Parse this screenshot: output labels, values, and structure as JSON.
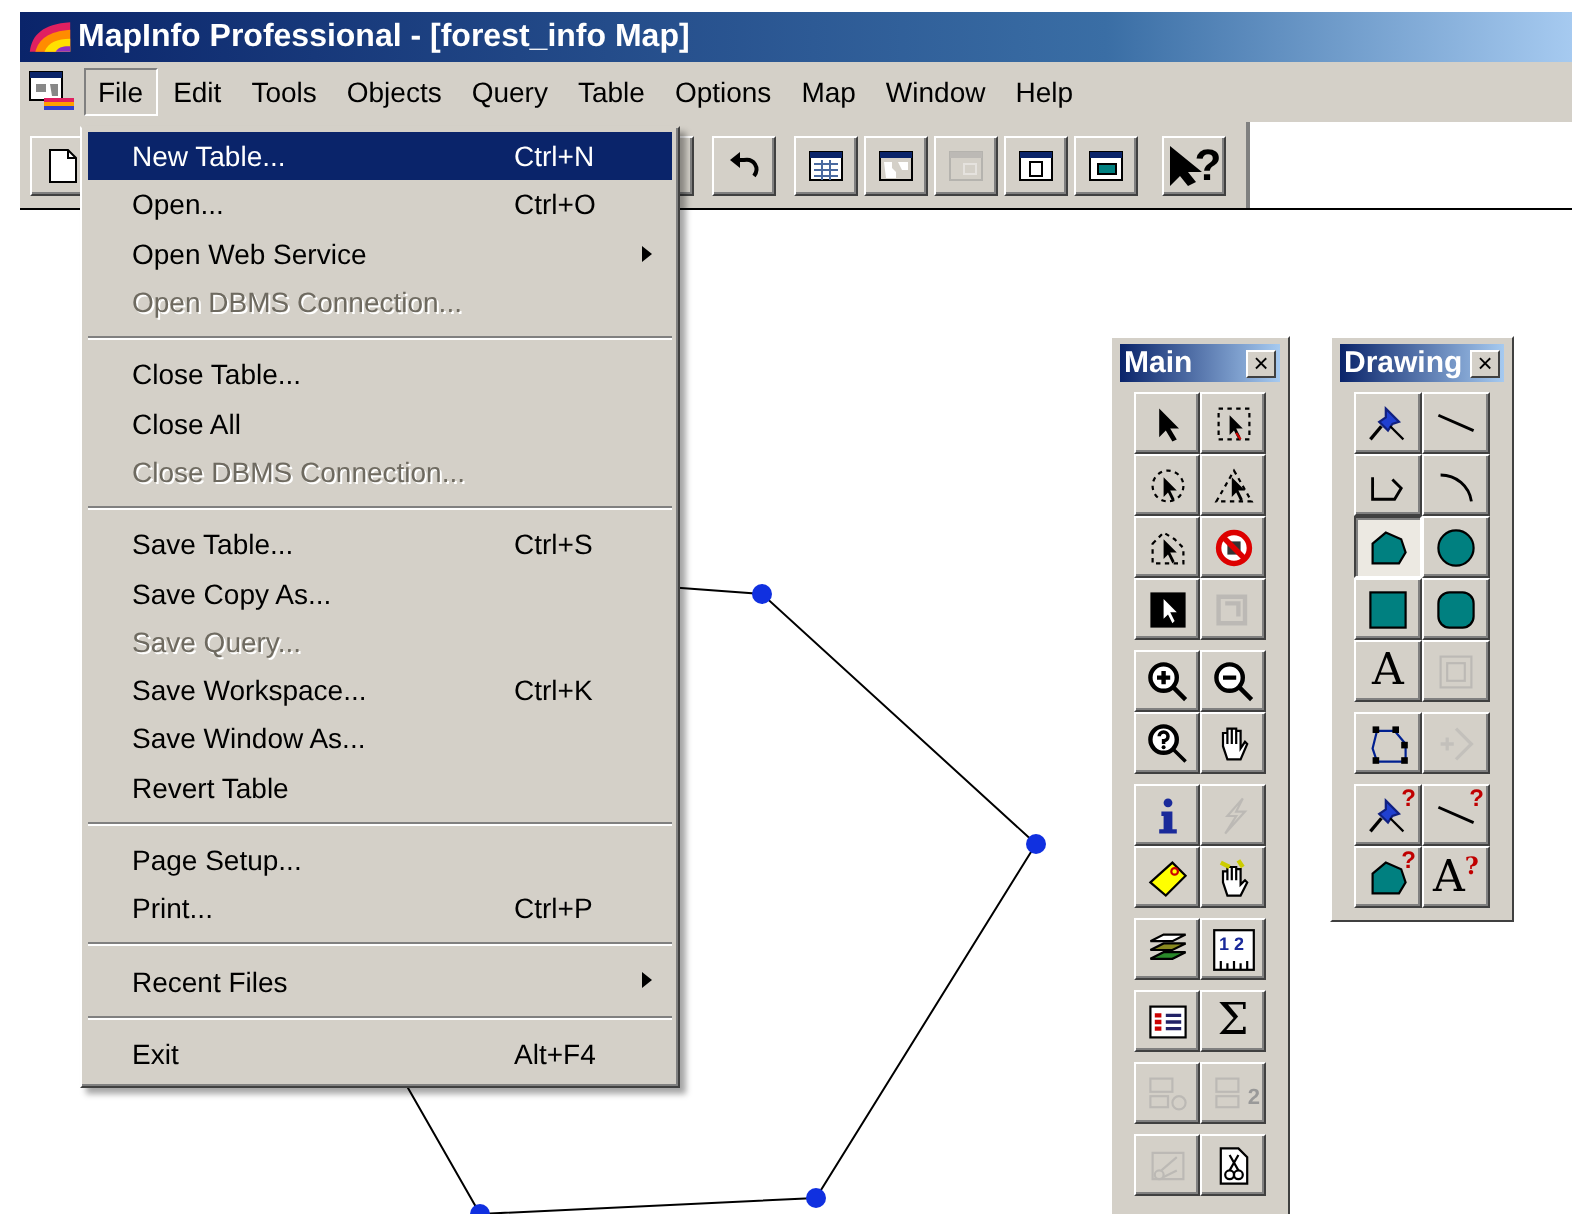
{
  "window": {
    "title": "MapInfo Professional - [forest_info Map]"
  },
  "menu_bar": [
    {
      "label": "File",
      "selected": true
    },
    {
      "label": "Edit",
      "selected": false
    },
    {
      "label": "Tools",
      "selected": false
    },
    {
      "label": "Objects",
      "selected": false
    },
    {
      "label": "Query",
      "selected": false
    },
    {
      "label": "Table",
      "selected": false
    },
    {
      "label": "Options",
      "selected": false
    },
    {
      "label": "Map",
      "selected": false
    },
    {
      "label": "Window",
      "selected": false
    },
    {
      "label": "Help",
      "selected": false
    }
  ],
  "toolbar": [
    [
      {
        "kind": "new-document",
        "disabled": false
      }
    ],
    [
      {
        "kind": "blank"
      }
    ],
    [
      {
        "kind": "undo",
        "disabled": false
      }
    ],
    [
      {
        "kind": "browser-window",
        "disabled": false
      },
      {
        "kind": "map-window",
        "disabled": false
      },
      {
        "kind": "layout-window",
        "disabled": true
      },
      {
        "kind": "graph-window",
        "disabled": false
      },
      {
        "kind": "district-window",
        "disabled": false
      }
    ],
    [
      {
        "kind": "help-pointer",
        "glyph": "?",
        "disabled": false
      }
    ]
  ],
  "file_menu": [
    {
      "kind": "item",
      "label": "New Table...",
      "shortcut": "Ctrl+N",
      "disabled": false,
      "selected": true
    },
    {
      "kind": "item",
      "label": "Open...",
      "shortcut": "Ctrl+O",
      "disabled": false,
      "selected": false
    },
    {
      "kind": "item",
      "label": "Open Web Service",
      "submenu": true,
      "disabled": false,
      "selected": false
    },
    {
      "kind": "item",
      "label": "Open DBMS Connection...",
      "disabled": true,
      "selected": false
    },
    {
      "kind": "separator"
    },
    {
      "kind": "item",
      "label": "Close Table...",
      "disabled": false,
      "selected": false
    },
    {
      "kind": "item",
      "label": "Close All",
      "disabled": false,
      "selected": false
    },
    {
      "kind": "item",
      "label": "Close DBMS Connection...",
      "disabled": true,
      "selected": false
    },
    {
      "kind": "separator"
    },
    {
      "kind": "item",
      "label": "Save Table...",
      "shortcut": "Ctrl+S",
      "disabled": false,
      "selected": false
    },
    {
      "kind": "item",
      "label": "Save Copy As...",
      "disabled": false,
      "selected": false
    },
    {
      "kind": "item",
      "label": "Save Query...",
      "disabled": true,
      "selected": false
    },
    {
      "kind": "item",
      "label": "Save Workspace...",
      "shortcut": "Ctrl+K",
      "disabled": false,
      "selected": false
    },
    {
      "kind": "item",
      "label": "Save Window As...",
      "disabled": false,
      "selected": false
    },
    {
      "kind": "item",
      "label": "Revert Table",
      "disabled": false,
      "selected": false
    },
    {
      "kind": "separator"
    },
    {
      "kind": "item",
      "label": "Page Setup...",
      "disabled": false,
      "selected": false
    },
    {
      "kind": "item",
      "label": "Print...",
      "shortcut": "Ctrl+P",
      "disabled": false,
      "selected": false
    },
    {
      "kind": "separator"
    },
    {
      "kind": "item",
      "label": "Recent Files",
      "submenu": true,
      "disabled": false,
      "selected": false
    },
    {
      "kind": "separator"
    },
    {
      "kind": "item",
      "label": "Exit",
      "shortcut": "Alt+F4",
      "disabled": false,
      "selected": false
    }
  ],
  "palettes": [
    {
      "title": "Main",
      "close": "×",
      "groups": [
        [
          {
            "kind": "arrow",
            "disabled": false,
            "selected": false
          },
          {
            "kind": "marquee-select",
            "disabled": false,
            "selected": false
          },
          {
            "kind": "radius-select",
            "disabled": false,
            "selected": false
          },
          {
            "kind": "triangle-select",
            "disabled": false,
            "selected": false
          },
          {
            "kind": "boundary-select",
            "disabled": false,
            "selected": false
          },
          {
            "kind": "prohibited",
            "disabled": false,
            "selected": false
          },
          {
            "kind": "inverted-arrow",
            "disabled": false,
            "selected": false
          },
          {
            "kind": "graph-select",
            "disabled": true,
            "selected": false
          }
        ],
        [
          {
            "kind": "zoom-in",
            "disabled": false,
            "selected": false
          },
          {
            "kind": "zoom-out",
            "disabled": false,
            "selected": false
          },
          {
            "kind": "zoom-help",
            "disabled": false,
            "selected": false
          },
          {
            "kind": "hand",
            "disabled": false,
            "selected": false
          }
        ],
        [
          {
            "kind": "info",
            "disabled": false,
            "selected": false
          },
          {
            "kind": "lightning",
            "disabled": true,
            "selected": false
          },
          {
            "kind": "tag",
            "disabled": false,
            "selected": false
          },
          {
            "kind": "pointing-hand",
            "disabled": false,
            "selected": false
          }
        ],
        [
          {
            "kind": "layers",
            "disabled": false,
            "selected": false
          },
          {
            "kind": "ruler",
            "glyph": "1 2",
            "disabled": false,
            "selected": false
          }
        ],
        [
          {
            "kind": "legend",
            "disabled": false,
            "selected": false
          },
          {
            "kind": "text",
            "glyph": "Σ",
            "disabled": false,
            "selected": false
          }
        ],
        [
          {
            "kind": "network",
            "disabled": true,
            "selected": false
          },
          {
            "kind": "stacked-boxes",
            "glyph": "2",
            "disabled": true,
            "selected": false
          }
        ],
        [
          {
            "kind": "scissors-frame",
            "disabled": true,
            "selected": false
          },
          {
            "kind": "scissors-page",
            "disabled": false,
            "selected": false
          }
        ]
      ]
    },
    {
      "title": "Drawing",
      "close": "×",
      "groups": [
        [
          {
            "kind": "pushpin",
            "disabled": false,
            "selected": false
          },
          {
            "kind": "line",
            "disabled": false,
            "selected": false
          },
          {
            "kind": "polyline",
            "disabled": false,
            "selected": false
          },
          {
            "kind": "arc",
            "disabled": false,
            "selected": false
          },
          {
            "kind": "polygon",
            "disabled": false,
            "selected": true
          },
          {
            "kind": "ellipse",
            "disabled": false,
            "selected": false
          },
          {
            "kind": "rectangle",
            "disabled": false,
            "selected": false
          },
          {
            "kind": "rounded-rectangle",
            "disabled": false,
            "selected": false
          },
          {
            "kind": "text",
            "glyph": "A",
            "disabled": false,
            "selected": false
          },
          {
            "kind": "frame",
            "disabled": true,
            "selected": false
          }
        ],
        [
          {
            "kind": "reshape",
            "disabled": false,
            "selected": false
          },
          {
            "kind": "add-node",
            "disabled": true,
            "selected": false
          }
        ],
        [
          {
            "kind": "pushpin",
            "glyph": "?",
            "disabled": false,
            "selected": false
          },
          {
            "kind": "line",
            "glyph": "?",
            "disabled": false,
            "selected": false
          },
          {
            "kind": "polygon",
            "glyph": "?",
            "disabled": false,
            "selected": false
          },
          {
            "kind": "text",
            "glyph": "A$^{?}$",
            "disabled": false,
            "selected": false
          }
        ]
      ]
    }
  ]
}
